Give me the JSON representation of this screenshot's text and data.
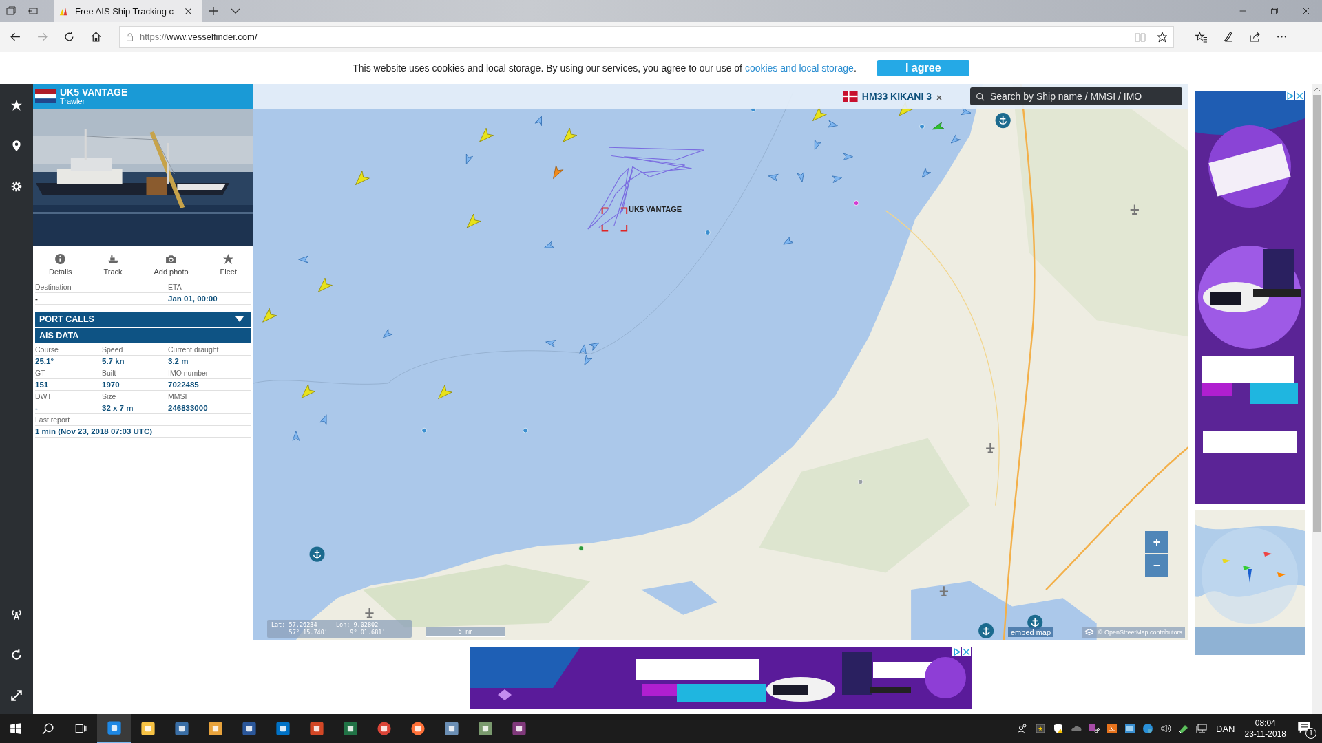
{
  "browser": {
    "tab_title": "Free AIS Ship Tracking c",
    "url_scheme": "https://",
    "url_host": "www.vesselfinder.com/"
  },
  "cookie_notice": {
    "text": "This website uses cookies and local storage. By using our services, you agree to our use of ",
    "link": "cookies and local storage",
    "end": ".",
    "button": "I agree"
  },
  "vessel": {
    "name": "UK5 VANTAGE",
    "type": "Trawler",
    "actions": [
      {
        "kind": "details",
        "label": "Details"
      },
      {
        "kind": "track",
        "label": "Track"
      },
      {
        "label": "Add photo"
      },
      {
        "kind": "fleet",
        "label": "Fleet"
      }
    ],
    "voyage": [
      {
        "label": "Destination",
        "value": "-"
      },
      {
        "label": "ETA",
        "value": "Jan 01, 00:00"
      }
    ],
    "port_calls": {
      "title": "PORT CALLS",
      "expanded": false
    },
    "ais_data": {
      "title": "AIS DATA",
      "fields": [
        {
          "label": "Course",
          "value": "25.1°"
        },
        {
          "label": "Speed",
          "value": "5.7 kn"
        },
        {
          "label": "Current draught",
          "value": "3.2 m"
        },
        {
          "label": "GT",
          "value": "151"
        },
        {
          "label": "Built",
          "value": "1970"
        },
        {
          "label": "IMO number",
          "value": "7022485"
        },
        {
          "label": "DWT",
          "value": "-"
        },
        {
          "label": "Size",
          "value": "32 x 7 m"
        },
        {
          "label": "MMSI",
          "value": "246833000"
        }
      ],
      "last_report": {
        "label": "Last report",
        "value": "1 min (Nov 23, 2018 07:03 UTC)"
      }
    }
  },
  "map": {
    "pinned_vessel": {
      "name": "HM33 KIKANI 3"
    },
    "search": {
      "placeholder": "Search by Ship name / MMSI / IMO"
    },
    "vessel_label": "UK5 VANTAGE",
    "position": {
      "lat_label": "Lat:",
      "lat": "57.26234",
      "lat_dms": "57° 15.740′",
      "lon_label": "Lon:",
      "lon": "9.02802",
      "lon_dms": "9° 01.681′"
    },
    "scale": "5 nm",
    "zoom_in": "+",
    "zoom_out": "−",
    "embed": "embed map",
    "attribution": "© OpenStreetMap contributors"
  },
  "taskbar": {
    "apps": [
      {
        "kind": "browser",
        "selected": true
      },
      {
        "kind": "folder",
        "selected": false
      },
      {
        "kind": "store",
        "selected": false
      },
      {
        "kind": "media",
        "selected": false
      },
      {
        "kind": "document",
        "selected": false
      },
      {
        "kind": "mail",
        "selected": false
      },
      {
        "kind": "slides",
        "selected": false
      },
      {
        "kind": "sheet",
        "selected": false
      },
      {
        "kind": "globe",
        "selected": false
      },
      {
        "kind": "fox",
        "selected": false
      },
      {
        "kind": "monitor",
        "selected": false
      },
      {
        "kind": "tool",
        "selected": false
      },
      {
        "kind": "notebook",
        "selected": false
      }
    ],
    "language": "DAN",
    "time": "08:04",
    "date": "23-11-2018",
    "notifications": "1"
  }
}
